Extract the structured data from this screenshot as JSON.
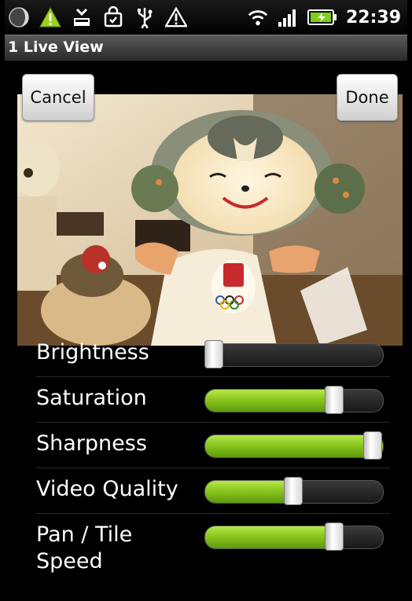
{
  "status_bar": {
    "time": "22:39",
    "left_icons": [
      "moon-icon",
      "warning-triangle-icon",
      "download-icon",
      "bag-icon",
      "usb-icon",
      "alert-icon"
    ],
    "right_icons": [
      "wifi-icon",
      "signal-icon",
      "battery-icon"
    ]
  },
  "title_bar": {
    "title": "1 Live View"
  },
  "video": {
    "cancel_label": "Cancel",
    "done_label": "Done"
  },
  "settings": [
    {
      "label": "Brightness",
      "level": 0.04
    },
    {
      "label": "Saturation",
      "level": 0.73
    },
    {
      "label": "Sharpness",
      "level": 1.0
    },
    {
      "label": "Video Quality",
      "level": 0.5
    },
    {
      "label": "Pan / Tile Speed",
      "level": 0.73
    }
  ],
  "colors": {
    "accent": "#86c21a",
    "background": "#000000"
  }
}
